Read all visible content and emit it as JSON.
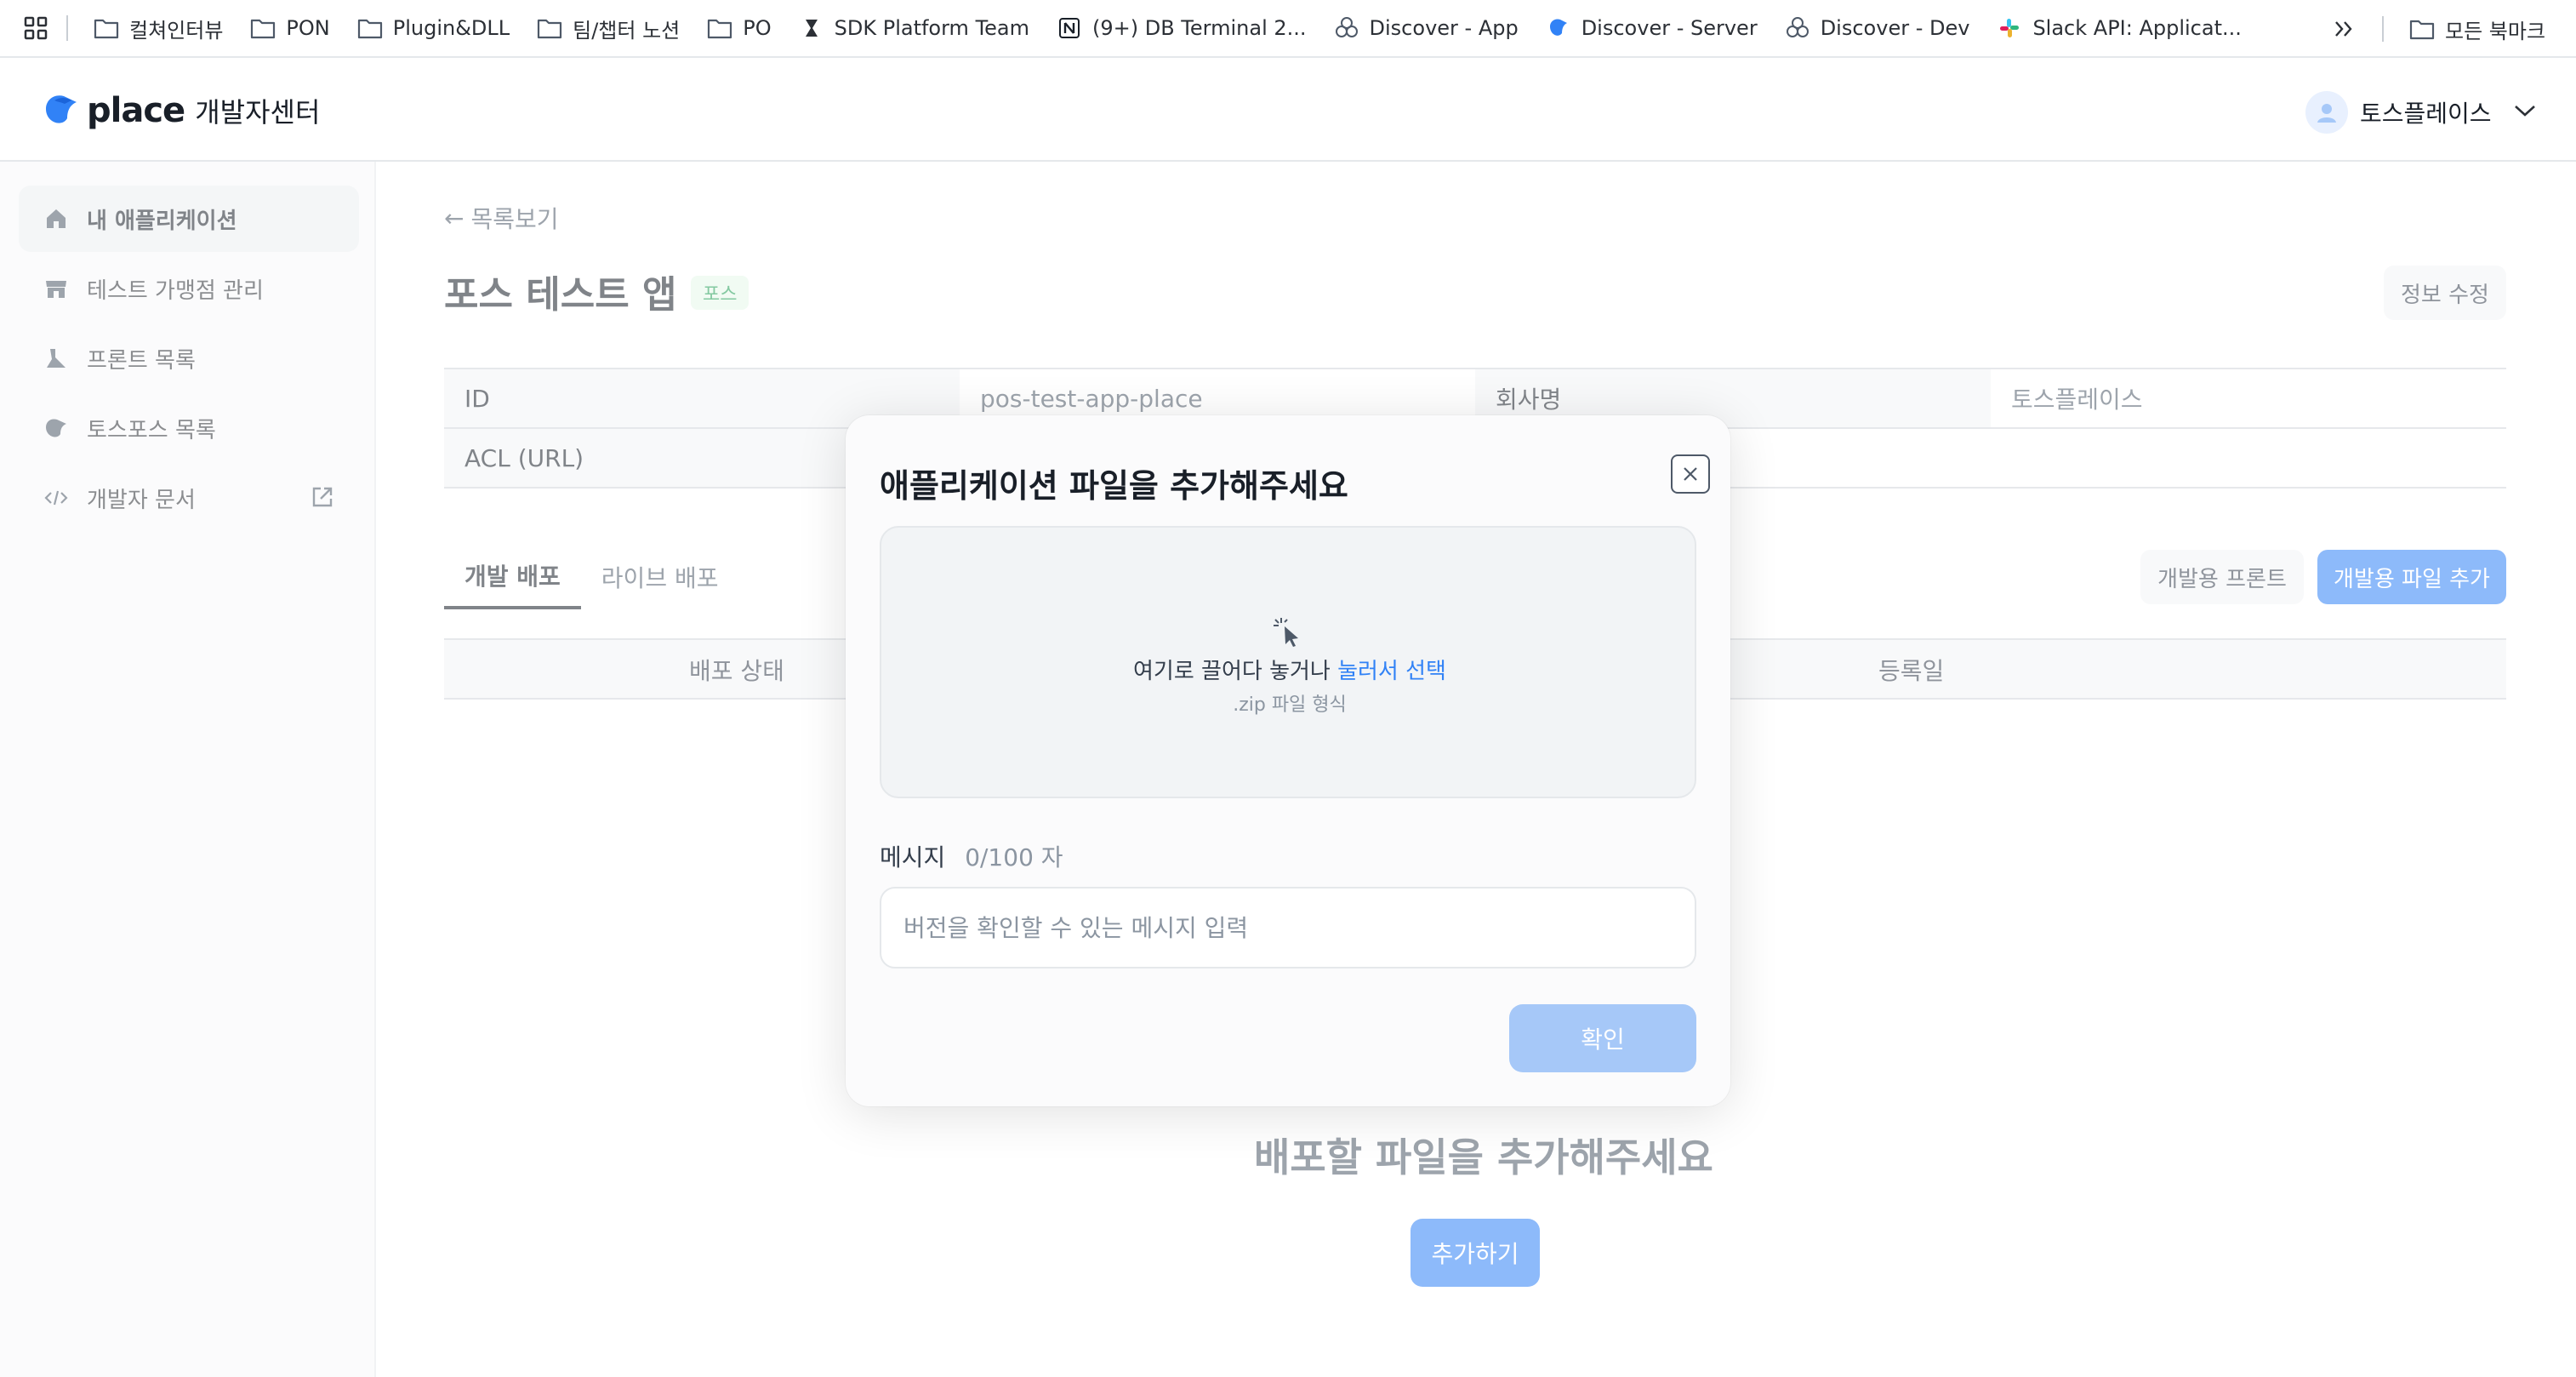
{
  "bookmarks": {
    "items": [
      {
        "label": "컬쳐인터뷰",
        "icon": "folder-icon"
      },
      {
        "label": "PON",
        "icon": "folder-icon"
      },
      {
        "label": "Plugin&DLL",
        "icon": "folder-icon"
      },
      {
        "label": "팀/챕터 노션",
        "icon": "folder-icon"
      },
      {
        "label": "PO",
        "icon": "folder-icon"
      },
      {
        "label": "SDK Platform Team",
        "icon": "sdk-icon"
      },
      {
        "label": "(9+) DB Terminal 2...",
        "icon": "notion-icon"
      },
      {
        "label": "Discover - App",
        "icon": "discover-icon"
      },
      {
        "label": "Discover - Server",
        "icon": "toss-icon"
      },
      {
        "label": "Discover - Dev",
        "icon": "discover-icon"
      },
      {
        "label": "Slack API: Applicat...",
        "icon": "slack-icon"
      }
    ],
    "all_bookmarks": "모든 북마크"
  },
  "header": {
    "logo_word": "place",
    "logo_sub": "개발자센터",
    "user_name": "토스플레이스"
  },
  "sidebar": {
    "items": [
      {
        "label": "내 애플리케이션",
        "icon": "home-icon"
      },
      {
        "label": "테스트 가맹점 관리",
        "icon": "store-icon"
      },
      {
        "label": "프론트 목록",
        "icon": "front-icon"
      },
      {
        "label": "토스포스 목록",
        "icon": "tosspos-icon"
      },
      {
        "label": "개발자 문서",
        "icon": "code-icon"
      }
    ]
  },
  "main": {
    "back_link": "목록보기",
    "app_title": "포스 테스트 앱",
    "app_badge": "포스",
    "edit_button": "정보 수정",
    "info": {
      "id_label": "ID",
      "id_value": "pos-test-app-place",
      "company_label": "회사명",
      "company_value": "토스플레이스",
      "acl_label": "ACL (URL)"
    },
    "tabs": [
      "개발 배포",
      "라이브 배포"
    ],
    "dev_front_button": "개발용 프론트",
    "dev_file_button": "개발용 파일 추가",
    "columns": {
      "status": "배포 상태",
      "date": "등록일"
    },
    "empty_title": "배포할 파일을 추가해주세요",
    "empty_button": "추가하기"
  },
  "modal": {
    "title": "애플리케이션 파일을 추가해주세요",
    "drop_text": "여기로 끌어다 놓거나",
    "drop_link": "눌러서 선택",
    "drop_sub": ".zip 파일 형식",
    "message_label": "메시지",
    "message_count": "0/100 자",
    "message_placeholder": "버전을 확인할 수 있는 메시지 입력",
    "message_value": "",
    "confirm_button": "확인"
  },
  "colors": {
    "accent": "#3182f6",
    "accent_disabled": "#a6c8f8",
    "badge_bg": "#e5f7ea",
    "badge_text": "#1f9d55"
  }
}
